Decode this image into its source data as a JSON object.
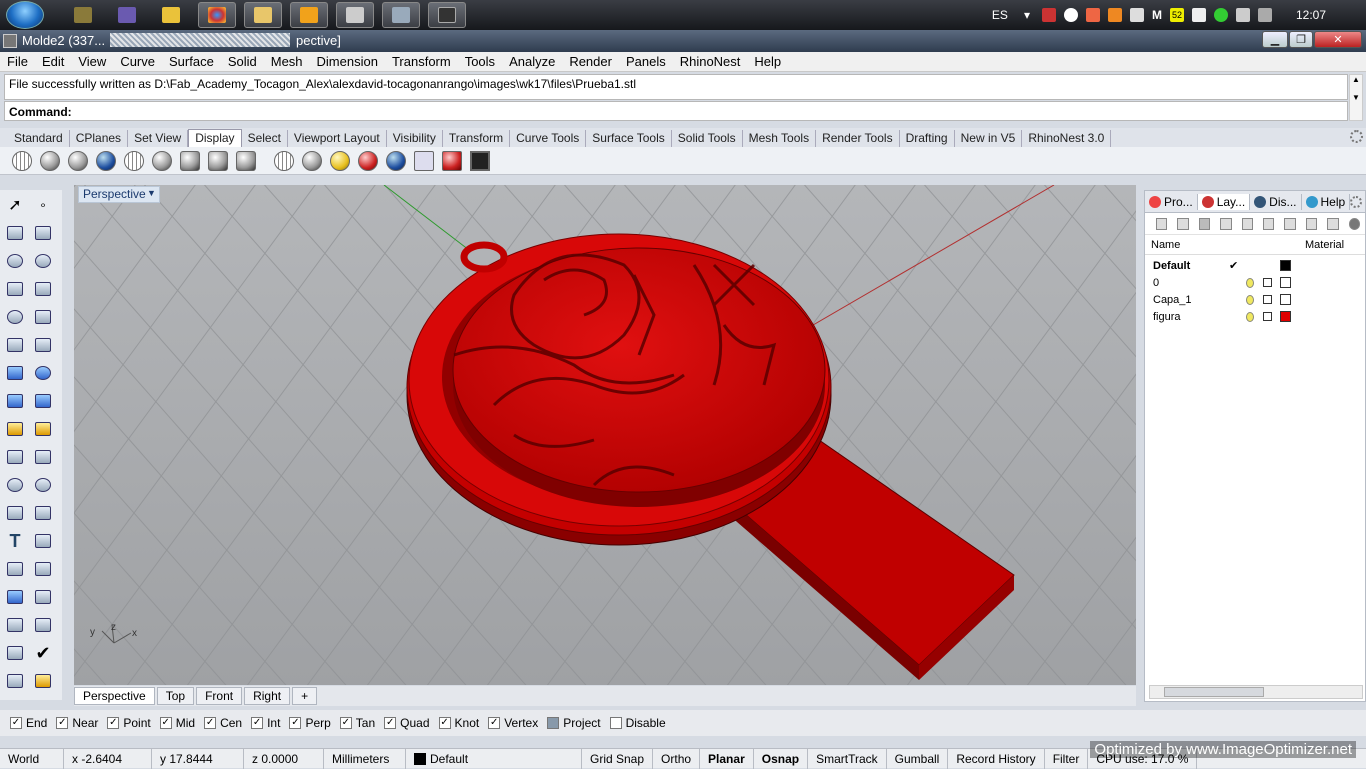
{
  "window": {
    "title": "Molde2 (337...",
    "title_suffix": "pective]"
  },
  "tray": {
    "lang": "ES",
    "badge": "52",
    "time": "12:07"
  },
  "menu": [
    "File",
    "Edit",
    "View",
    "Curve",
    "Surface",
    "Solid",
    "Mesh",
    "Dimension",
    "Transform",
    "Tools",
    "Analyze",
    "Render",
    "Panels",
    "RhinoNest",
    "Help"
  ],
  "command": {
    "history": "File successfully written as D:\\Fab_Academy_Tocagon_Alex\\alexdavid-tocagonanrango\\images\\wk17\\files\\Prueba1.stl",
    "prompt": "Command:"
  },
  "toolbar_tabs": [
    "Standard",
    "CPlanes",
    "Set View",
    "Display",
    "Select",
    "Viewport Layout",
    "Visibility",
    "Transform",
    "Curve Tools",
    "Surface Tools",
    "Solid Tools",
    "Mesh Tools",
    "Render Tools",
    "Drafting",
    "New in V5",
    "RhinoNest 3.0"
  ],
  "active_toolbar_tab": "Display",
  "viewport": {
    "title": "Perspective",
    "axis_y": "y",
    "axis_z": "z",
    "axis_x": "x"
  },
  "viewport_tabs": [
    "Perspective",
    "Top",
    "Front",
    "Right"
  ],
  "panel": {
    "tabs": [
      "Pro...",
      "Lay...",
      "Dis...",
      "Help"
    ],
    "columns": {
      "name": "Name",
      "material": "Material"
    },
    "layers": [
      {
        "name": "Default",
        "current": "✔",
        "color": "#000000"
      },
      {
        "name": "0",
        "current": "",
        "color": "#ffffff"
      },
      {
        "name": "Capa_1",
        "current": "",
        "color": "#ffffff"
      },
      {
        "name": "figura",
        "current": "",
        "color": "#e00000"
      }
    ]
  },
  "osnaps": [
    {
      "label": "End",
      "checked": true
    },
    {
      "label": "Near",
      "checked": true
    },
    {
      "label": "Point",
      "checked": true
    },
    {
      "label": "Mid",
      "checked": true
    },
    {
      "label": "Cen",
      "checked": true
    },
    {
      "label": "Int",
      "checked": true
    },
    {
      "label": "Perp",
      "checked": true
    },
    {
      "label": "Tan",
      "checked": true
    },
    {
      "label": "Quad",
      "checked": true
    },
    {
      "label": "Knot",
      "checked": true
    },
    {
      "label": "Vertex",
      "checked": true
    },
    {
      "label": "Project",
      "checked": false
    },
    {
      "label": "Disable",
      "checked": false
    }
  ],
  "status": {
    "cplane": "World",
    "x": "x -2.6404",
    "y": "y 17.8444",
    "z": "z 0.0000",
    "units": "Millimeters",
    "layer": "Default",
    "grid_snap": "Grid Snap",
    "ortho": "Ortho",
    "planar": "Planar",
    "osnap": "Osnap",
    "smarttrack": "SmartTrack",
    "gumball": "Gumball",
    "record_history": "Record History",
    "filter": "Filter",
    "cpu": "CPU use: 17.0 %"
  },
  "watermark": "Optimized by www.ImageOptimizer.net",
  "colors": {
    "model": "#e00000",
    "viewport_bg": "#a7a9ac",
    "grid": "#9a9c9f"
  }
}
